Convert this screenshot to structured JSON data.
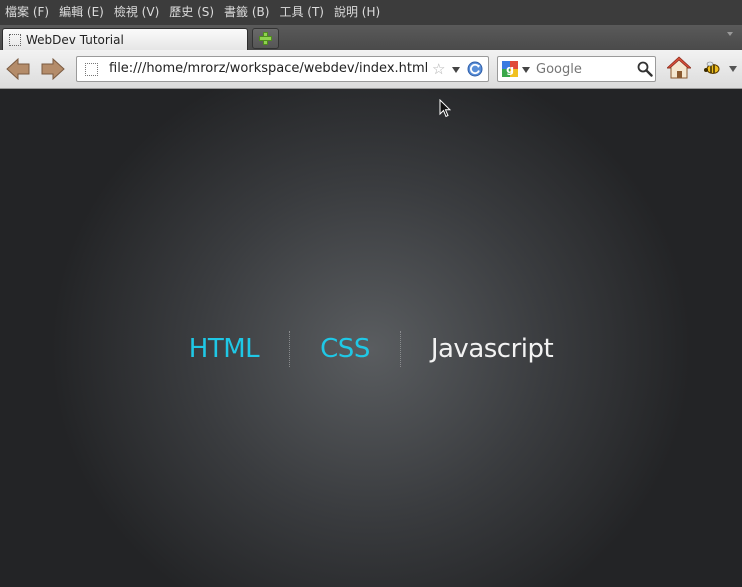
{
  "menubar": {
    "items": [
      {
        "label": "檔案 (F)"
      },
      {
        "label": "編輯 (E)"
      },
      {
        "label": "檢視 (V)"
      },
      {
        "label": "歷史 (S)"
      },
      {
        "label": "書籤 (B)"
      },
      {
        "label": "工具 (T)"
      },
      {
        "label": "說明 (H)"
      }
    ]
  },
  "tabs": [
    {
      "title": "WebDev Tutorial",
      "active": true
    }
  ],
  "navbar": {
    "url": "file:///home/mrorz/workspace/webdev/index.html",
    "search_placeholder": "Google",
    "icons": [
      "back-arrow-icon",
      "forward-arrow-icon",
      "bookmark-star-icon",
      "reload-icon",
      "google-icon",
      "search-icon",
      "home-icon",
      "bee-icon"
    ]
  },
  "page": {
    "links": [
      {
        "label": "HTML",
        "active": true
      },
      {
        "label": "CSS",
        "active": true
      },
      {
        "label": "Javascript",
        "active": false
      }
    ],
    "colors": {
      "link_accent": "#1fc8e6",
      "link_plain": "#f2f2f2"
    }
  }
}
